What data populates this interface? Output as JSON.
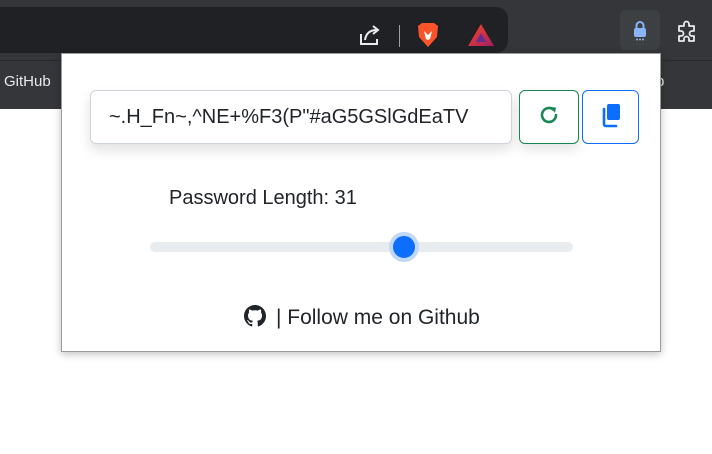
{
  "bookmarks": {
    "github_label": "GitHub",
    "right_label": "p"
  },
  "toolbar": {
    "icons": [
      "share-icon",
      "brave-icon",
      "brave-rewards-icon",
      "password-extension-icon",
      "extensions-puzzle-icon"
    ]
  },
  "popup": {
    "password_value": "~.H_Fn~,^NE+%F3(P\"#aG5GSlGdEaTV",
    "length_label": "Password Length:",
    "length_value": "31",
    "slider_level_fraction": 0.6,
    "refresh_icon": "refresh-icon",
    "copy_icon": "copy-icon",
    "footer_text": "| Follow me on Github",
    "footer_icon": "github-icon"
  },
  "colors": {
    "refresh_accent": "#198754",
    "copy_accent": "#0d6efd",
    "slider_thumb": "#0d6efd",
    "chrome_bg": "#35363a"
  }
}
